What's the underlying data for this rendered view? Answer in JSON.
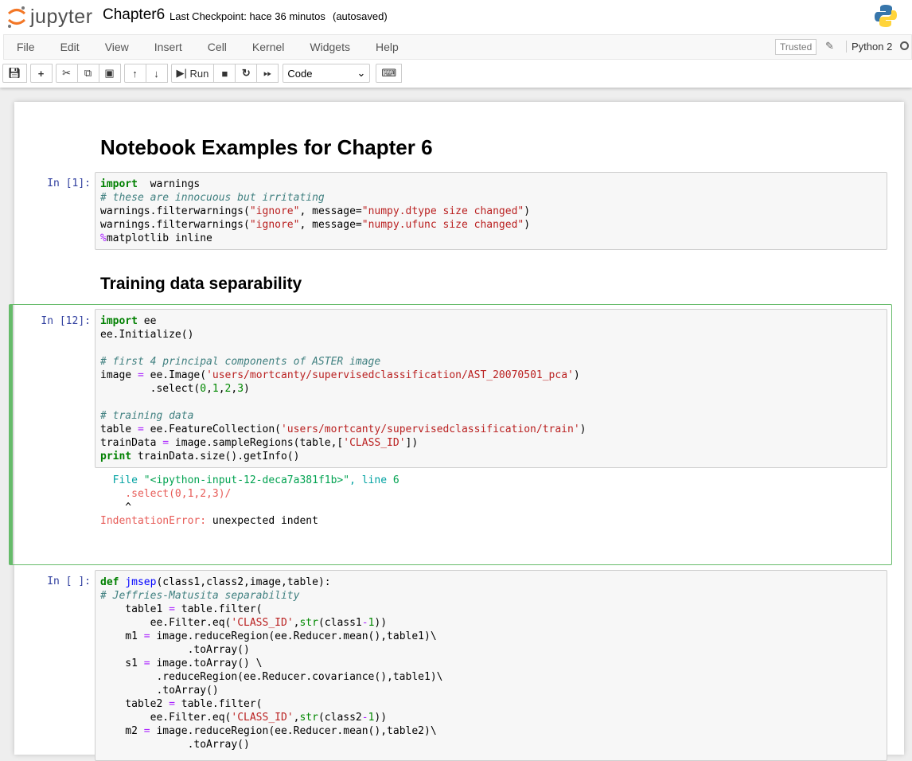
{
  "header": {
    "logo_text": "jupyter",
    "notebook_name": "Chapter6",
    "checkpoint": "Last Checkpoint: hace 36 minutos",
    "autosave": "(autosaved)"
  },
  "menubar": {
    "items": [
      "File",
      "Edit",
      "View",
      "Insert",
      "Cell",
      "Kernel",
      "Widgets",
      "Help"
    ],
    "trusted": "Trusted",
    "kernel": "Python 2"
  },
  "toolbar": {
    "run_label": "Run",
    "cell_type": "Code"
  },
  "colors": {
    "selected_cell": "#66bb6a",
    "prompt": "#303f9f",
    "error": "#e75c58"
  },
  "cells": [
    {
      "type": "heading",
      "text": "Notebook Examples for Chapter 6"
    },
    {
      "prompt": "In [1]:",
      "lines": [
        [
          [
            "k",
            "import"
          ],
          [
            "",
            "  warnings"
          ]
        ],
        [
          [
            "c",
            "# these are innocuous but irritating"
          ]
        ],
        [
          [
            "",
            "warnings.filterwarnings("
          ],
          [
            "s",
            "\"ignore\""
          ],
          [
            "",
            ", message="
          ],
          [
            "s",
            "\"numpy.dtype size changed\""
          ],
          [
            "",
            ")"
          ]
        ],
        [
          [
            "",
            "warnings.filterwarnings("
          ],
          [
            "s",
            "\"ignore\""
          ],
          [
            "",
            ", message="
          ],
          [
            "s",
            "\"numpy.ufunc size changed\""
          ],
          [
            "",
            ")"
          ]
        ],
        [
          [
            "o",
            "%"
          ],
          [
            "",
            "matplotlib inline"
          ]
        ]
      ]
    },
    {
      "type": "heading",
      "text": "Training data separability"
    },
    {
      "prompt": "In [12]:",
      "lines": [
        [
          [
            "k",
            "import"
          ],
          [
            "",
            " ee"
          ]
        ],
        [
          [
            "",
            "ee.Initialize()"
          ]
        ],
        [
          [
            "",
            ""
          ]
        ],
        [
          [
            "c",
            "# first 4 principal components of ASTER image"
          ]
        ],
        [
          [
            "",
            "image "
          ],
          [
            "o",
            "="
          ],
          [
            "",
            " ee.Image("
          ],
          [
            "s",
            "'users/mortcanty/supervisedclassification/AST_20070501_pca'"
          ],
          [
            "",
            ")"
          ]
        ],
        [
          [
            "",
            "        .select("
          ],
          [
            "n",
            "0"
          ],
          [
            "",
            ","
          ],
          [
            "n",
            "1"
          ],
          [
            "",
            ","
          ],
          [
            "n",
            "2"
          ],
          [
            "",
            ","
          ],
          [
            "n",
            "3"
          ],
          [
            "",
            ")"
          ]
        ],
        [
          [
            "",
            ""
          ]
        ],
        [
          [
            "c",
            "# training data"
          ]
        ],
        [
          [
            "",
            "table "
          ],
          [
            "o",
            "="
          ],
          [
            "",
            " ee.FeatureCollection("
          ],
          [
            "s",
            "'users/mortcanty/supervisedclassification/train'"
          ],
          [
            "",
            ")"
          ]
        ],
        [
          [
            "",
            "trainData "
          ],
          [
            "o",
            "="
          ],
          [
            "",
            " image.sampleRegions(table,["
          ],
          [
            "s",
            "'CLASS_ID'"
          ],
          [
            "",
            "])"
          ]
        ],
        [
          [
            "k",
            "print"
          ],
          [
            "",
            " trainData.size().getInfo()"
          ]
        ]
      ],
      "output": [
        [
          [
            "tc",
            "  File "
          ],
          [
            "tg",
            "\"<ipython-input-12-deca7a381f1b>\""
          ],
          [
            "tc",
            ", line "
          ],
          [
            "tg",
            "6"
          ]
        ],
        [
          [
            "tr",
            "    .select(0,1,2,3)/"
          ]
        ],
        [
          [
            "",
            "    ^"
          ]
        ],
        [
          [
            "tr",
            "IndentationError:"
          ],
          [
            "",
            " unexpected indent"
          ]
        ]
      ]
    },
    {
      "prompt": "In [ ]:",
      "lines": [
        [
          [
            "k",
            "def"
          ],
          [
            "",
            " "
          ],
          [
            "f",
            "jmsep"
          ],
          [
            "",
            "(class1,class2,image,table):"
          ]
        ],
        [
          [
            "c",
            "# Jeffries-Matusita separability"
          ]
        ],
        [
          [
            "",
            "    table1 "
          ],
          [
            "o",
            "="
          ],
          [
            "",
            " table.filter("
          ]
        ],
        [
          [
            "",
            "        ee.Filter.eq("
          ],
          [
            "s",
            "'CLASS_ID'"
          ],
          [
            "",
            ","
          ],
          [
            "n",
            "str"
          ],
          [
            "",
            "(class1"
          ],
          [
            "o",
            "-"
          ],
          [
            "n",
            "1"
          ],
          [
            "",
            "))"
          ]
        ],
        [
          [
            "",
            "    m1 "
          ],
          [
            "o",
            "="
          ],
          [
            "",
            " image.reduceRegion(ee.Reducer.mean(),table1)\\"
          ]
        ],
        [
          [
            "",
            "              .toArray()"
          ]
        ],
        [
          [
            "",
            "    s1 "
          ],
          [
            "o",
            "="
          ],
          [
            "",
            " image.toArray() \\"
          ]
        ],
        [
          [
            "",
            "         .reduceRegion(ee.Reducer.covariance(),table1)\\"
          ]
        ],
        [
          [
            "",
            "         .toArray()"
          ]
        ],
        [
          [
            "",
            "    table2 "
          ],
          [
            "o",
            "="
          ],
          [
            "",
            " table.filter("
          ]
        ],
        [
          [
            "",
            "        ee.Filter.eq("
          ],
          [
            "s",
            "'CLASS_ID'"
          ],
          [
            "",
            ","
          ],
          [
            "n",
            "str"
          ],
          [
            "",
            "(class2"
          ],
          [
            "o",
            "-"
          ],
          [
            "n",
            "1"
          ],
          [
            "",
            "))"
          ]
        ],
        [
          [
            "",
            "    m2 "
          ],
          [
            "o",
            "="
          ],
          [
            "",
            " image.reduceRegion(ee.Reducer.mean(),table2)\\"
          ]
        ],
        [
          [
            "",
            "              .toArray()"
          ]
        ]
      ]
    }
  ]
}
